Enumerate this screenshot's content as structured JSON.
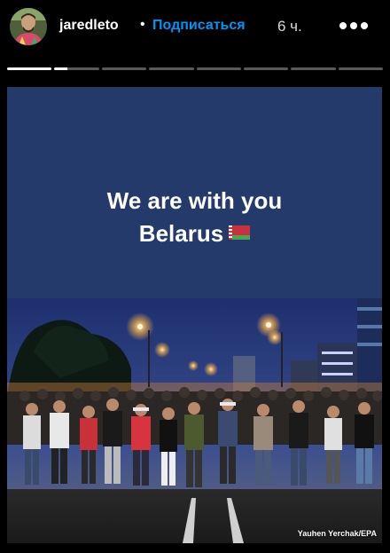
{
  "header": {
    "username": "jaredleto",
    "separator": "•",
    "follow_label": "Подписаться",
    "time_ago": "6 ч.",
    "more_icon": "more-horizontal-icon",
    "avatar_icon": "avatar-photo"
  },
  "progress": {
    "segment_count": 8,
    "active_index": 1,
    "active_fraction": 0.3
  },
  "story": {
    "headline_line1": "We are with you",
    "headline_line2": "Belarus",
    "flag_icon": "belarus-flag-icon",
    "background_color": "#233a6b",
    "photo_credit": "Yauhen Yerchak/EPA"
  }
}
